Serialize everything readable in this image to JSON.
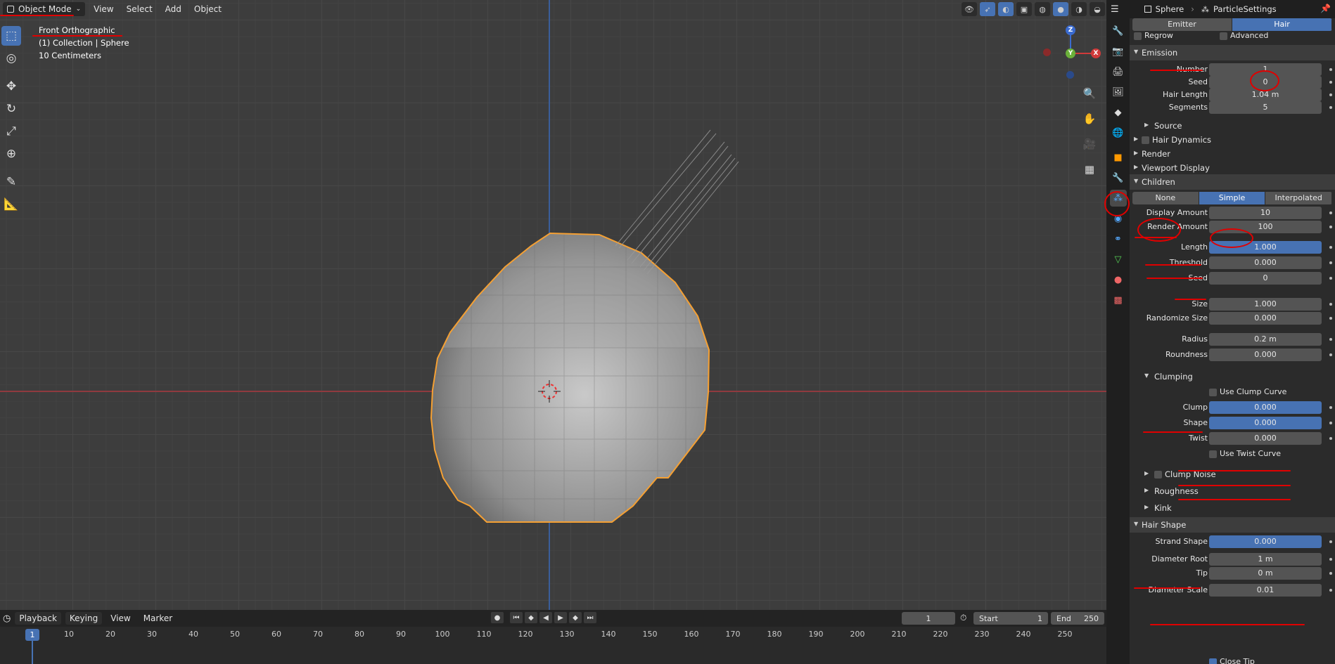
{
  "viewport": {
    "mode": "Object Mode",
    "menus": [
      "View",
      "Select",
      "Add",
      "Object"
    ],
    "info": {
      "view_name": "Front Orthographic",
      "collection": "(1) Collection | Sphere",
      "scale": "10 Centimeters"
    },
    "gizmo_axes": [
      "Z",
      "Y",
      "X"
    ]
  },
  "properties": {
    "breadcrumb_object": "Sphere",
    "breadcrumb_settings": "ParticleSettings",
    "type_options": [
      "Emitter",
      "Hair"
    ],
    "type_selected": "Hair",
    "regrow_label": "Regrow",
    "advanced_label": "Advanced",
    "emission": {
      "title": "Emission",
      "number_label": "Number",
      "number_value": "1",
      "seed_label": "Seed",
      "seed_value": "0",
      "hair_length_label": "Hair Length",
      "hair_length_value": "1.04 m",
      "segments_label": "Segments",
      "segments_value": "5",
      "source_label": "Source"
    },
    "hair_dynamics": "Hair Dynamics",
    "render": "Render",
    "viewport_display": "Viewport Display",
    "children": {
      "title": "Children",
      "options": [
        "None",
        "Simple",
        "Interpolated"
      ],
      "selected": "Simple",
      "display_amount_label": "Display Amount",
      "display_amount_value": "10",
      "render_amount_label": "Render Amount",
      "render_amount_value": "100",
      "length_label": "Length",
      "length_value": "1.000",
      "threshold_label": "Threshold",
      "threshold_value": "0.000",
      "seed_label": "Seed",
      "seed_value": "0",
      "size_label": "Size",
      "size_value": "1.000",
      "randomize_size_label": "Randomize Size",
      "randomize_size_value": "0.000",
      "radius_label": "Radius",
      "radius_value": "0.2 m",
      "roundness_label": "Roundness",
      "roundness_value": "0.000"
    },
    "clumping": {
      "title": "Clumping",
      "use_clump_curve": "Use Clump Curve",
      "clump_label": "Clump",
      "clump_value": "0.000",
      "shape_label": "Shape",
      "shape_value": "0.000",
      "twist_label": "Twist",
      "twist_value": "0.000",
      "use_twist_curve": "Use Twist Curve"
    },
    "clump_noise": "Clump Noise",
    "roughness": "Roughness",
    "kink": "Kink",
    "hair_shape": {
      "title": "Hair Shape",
      "strand_shape_label": "Strand Shape",
      "strand_shape_value": "0.000",
      "diameter_root_label": "Diameter Root",
      "diameter_root_value": "1 m",
      "tip_label": "Tip",
      "tip_value": "0 m",
      "diameter_scale_label": "Diameter Scale",
      "diameter_scale_value": "0.01",
      "close_tip_label": "Close Tip"
    }
  },
  "timeline": {
    "menus": [
      "Playback",
      "Keying",
      "View",
      "Marker"
    ],
    "current_frame": "1",
    "start_label": "Start",
    "start_value": "1",
    "end_label": "End",
    "end_value": "250",
    "ticks": [
      "10",
      "20",
      "30",
      "40",
      "50",
      "60",
      "70",
      "80",
      "90",
      "100",
      "110",
      "120",
      "130",
      "140",
      "150",
      "160",
      "170",
      "180",
      "190",
      "200",
      "210",
      "220",
      "230",
      "240",
      "250"
    ]
  },
  "colors": {
    "accent": "#4772b3",
    "selection_outline": "#f5a033",
    "annotation": "#e00000"
  }
}
